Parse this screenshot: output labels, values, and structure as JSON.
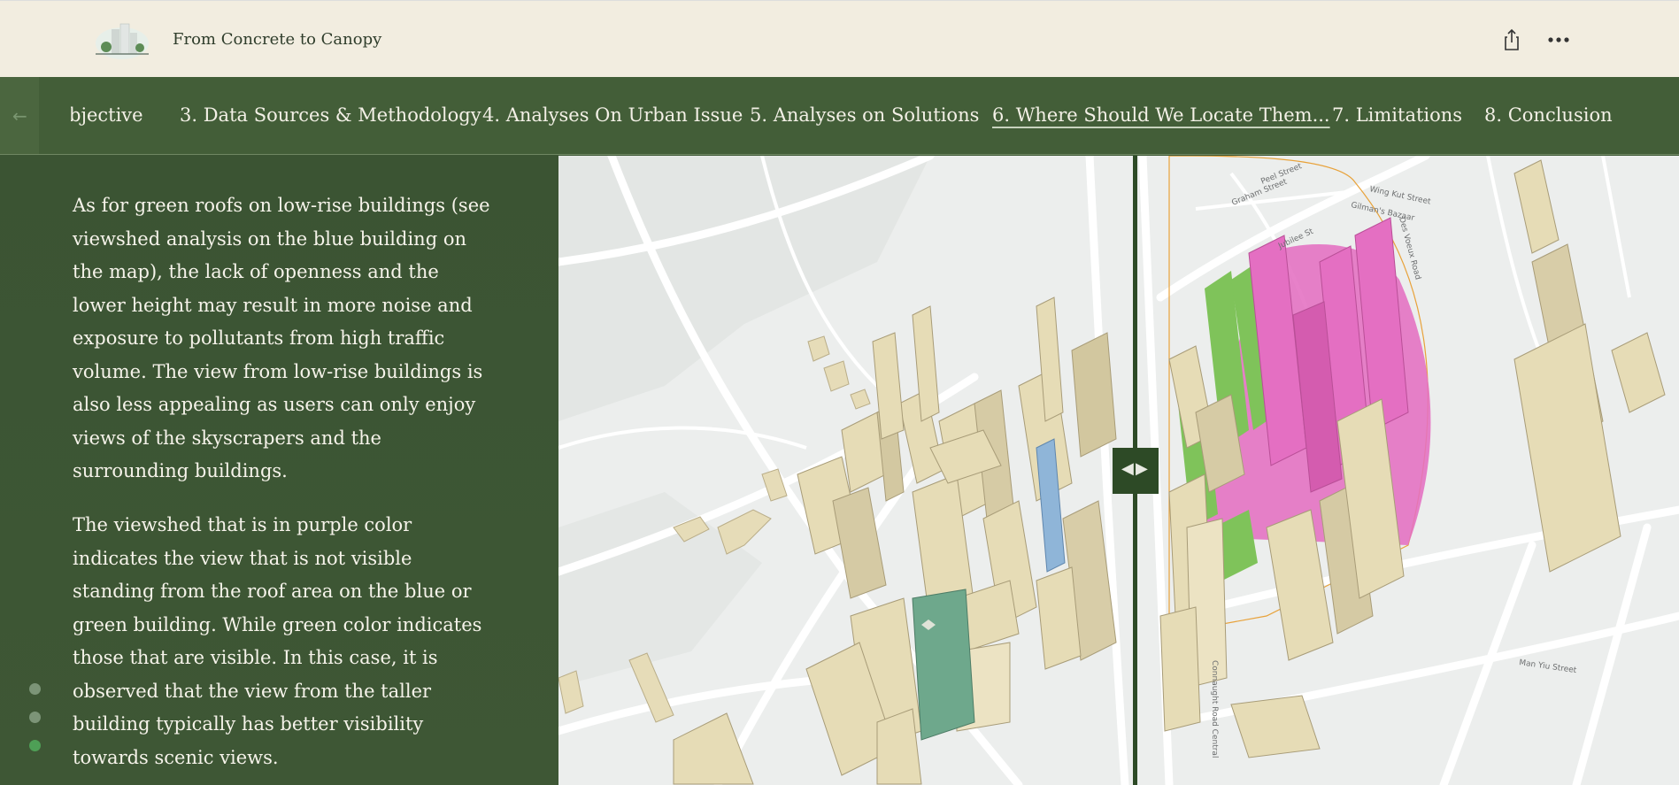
{
  "header": {
    "title": "From Concrete to Canopy",
    "logo_icon": "buildings-logo-icon",
    "share_icon": "share-icon",
    "more_icon": "more-horizontal-icon"
  },
  "nav": {
    "back_label": "←",
    "items": [
      {
        "label": "bjective",
        "active": false
      },
      {
        "label": "3. Data Sources & Methodology",
        "active": false
      },
      {
        "label": "4. Analyses On Urban Issue",
        "active": false
      },
      {
        "label": "5. Analyses on Solutions",
        "active": false
      },
      {
        "label": "6. Where Should We Locate Them...",
        "active": true
      },
      {
        "label": "7. Limitations",
        "active": false
      },
      {
        "label": "8. Conclusion",
        "active": false
      }
    ]
  },
  "content": {
    "para1": "As for green roofs on low-rise buildings (see viewshed analysis on the blue building on the map), the lack of openness and the lower height may result in more noise and exposure to pollutants from high traffic volume. The view from low-rise buildings is also less appealing as users can only enjoy views of the skyscrapers and the surrounding buildings.",
    "para2": "The viewshed that is in purple color indicates the view that is not visible standing from the roof area on the blue or green building. While green color indicates those that are visible. In this case, it is observed that the view from the taller building typically has better visibility towards scenic views."
  },
  "map": {
    "streets": [
      "Peel Street",
      "Graham Street",
      "Wing Kut Street",
      "Gilman's Bazaar",
      "Des Voeux Road",
      "Jubilee St",
      "Man Yiu Street",
      "Connaught Road Central"
    ],
    "swipe_left_icon": "chevron-left-icon",
    "swipe_right_icon": "chevron-right-icon",
    "colors": {
      "not_visible": "#e46fc2",
      "visible": "#7fc35a",
      "building": "#e7dcb6",
      "observer_blue": "#8fb5d8",
      "observer_green": "#6ea88c"
    }
  },
  "pagination": {
    "count": 3,
    "active_index": 2
  }
}
